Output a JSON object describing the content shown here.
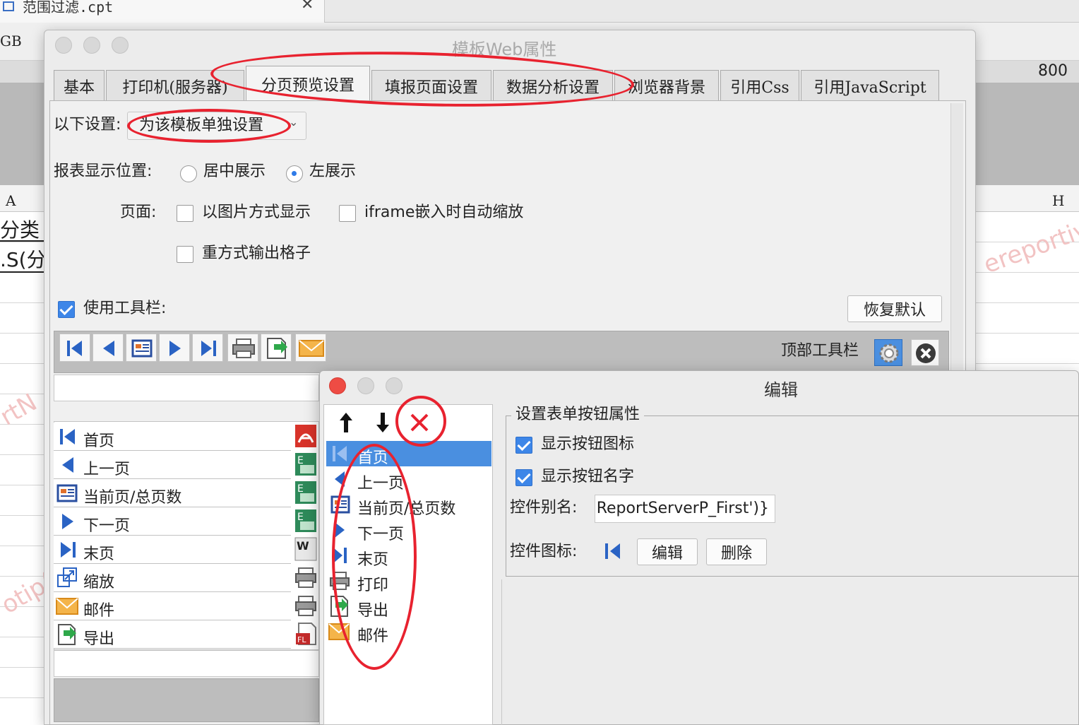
{
  "background": {
    "file_tab_title": "范围过滤.cpt",
    "encoding_label": "GB",
    "ruler_value": "800",
    "col_a": "A",
    "col_h": "H",
    "cell_1": "分类",
    "cell_2": ".S(分",
    "watermark_1": "ereportiv",
    "watermark_2": "rtN",
    "watermark_3": "otip("
  },
  "dialog": {
    "title": "模板Web属性",
    "tabs": [
      {
        "label": "基本"
      },
      {
        "label": "打印机(服务器)"
      },
      {
        "label": "分页预览设置"
      },
      {
        "label": "填报页面设置"
      },
      {
        "label": "数据分析设置"
      },
      {
        "label": "浏览器背景"
      },
      {
        "label": "引用Css"
      },
      {
        "label": "引用JavaScript"
      }
    ],
    "setting_label": "以下设置:",
    "setting_value": "为该模板单独设置",
    "position_label": "报表显示位置:",
    "position_options": [
      "居中展示",
      "左展示"
    ],
    "page_label": "页面:",
    "page_opt_image": "以图片方式显示",
    "page_opt_iframe": "iframe嵌入时自动缩放",
    "page_opt_grid": "重方式输出格子",
    "use_toolbar": "使用工具栏:",
    "restore_default": "恢复默认",
    "top_toolbar": "顶部工具栏",
    "button_list": [
      "首页",
      "上一页",
      "当前页/总页数",
      "下一页",
      "末页",
      "缩放",
      "邮件",
      "导出"
    ]
  },
  "edit_dialog": {
    "title": "编辑",
    "items": [
      "首页",
      "上一页",
      "当前页/总页数",
      "下一页",
      "末页",
      "打印",
      "导出",
      "邮件"
    ],
    "group_title": "设置表单按钮属性",
    "show_icon": "显示按钮图标",
    "show_name": "显示按钮名字",
    "alias_label": "控件别名:",
    "alias_value": "ReportServerP_First')}",
    "icon_label": "控件图标:",
    "edit_button": "编辑",
    "delete_button": "删除"
  },
  "colors": {
    "annotation_red": "#e8222f",
    "accent_blue": "#3d86e8",
    "selection_blue": "#4a8fe0"
  }
}
